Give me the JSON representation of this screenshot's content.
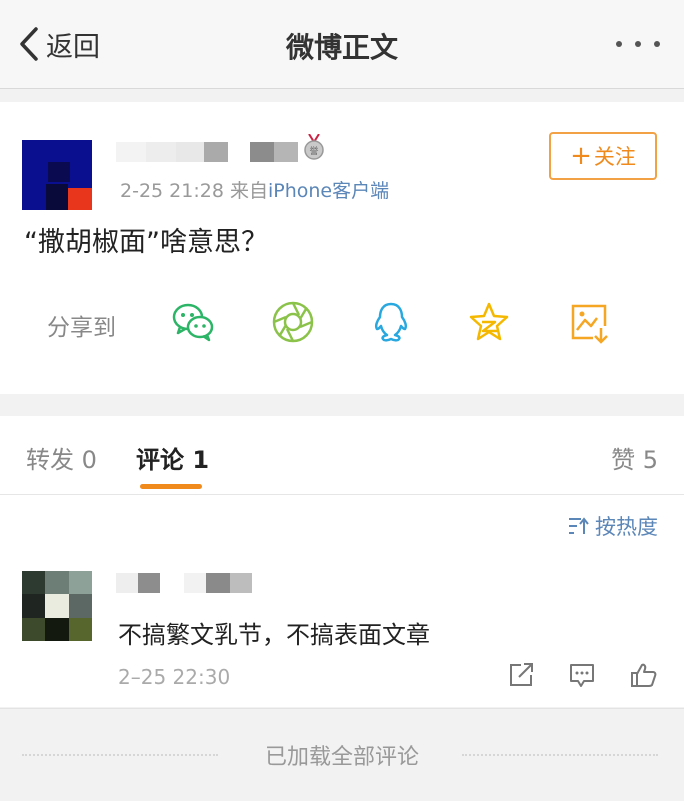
{
  "nav": {
    "back_label": "返回",
    "title": "微博正文",
    "more_icon": "more-icon"
  },
  "post": {
    "time": "2-25 21:28",
    "source_prefix": "来自",
    "source": "iPhone客户端",
    "follow_label": "关注",
    "content": "“撒胡椒面”啥意思？",
    "share_label": "分享到",
    "share_icons": [
      "wechat-icon",
      "moments-icon",
      "qq-icon",
      "qzone-icon",
      "save-image-icon"
    ]
  },
  "tabs": {
    "repost": "转发 0",
    "comment": "评论 1",
    "like": "赞 5"
  },
  "comments": {
    "sort_label": "按热度",
    "items": [
      {
        "text": "不搞繁文乳节，不搞表面文章",
        "time": "2–25 22:30"
      }
    ]
  },
  "footer": {
    "text": "已加载全部评论"
  },
  "colors": {
    "accent": "#f08a1d",
    "link": "#5b86b8"
  }
}
